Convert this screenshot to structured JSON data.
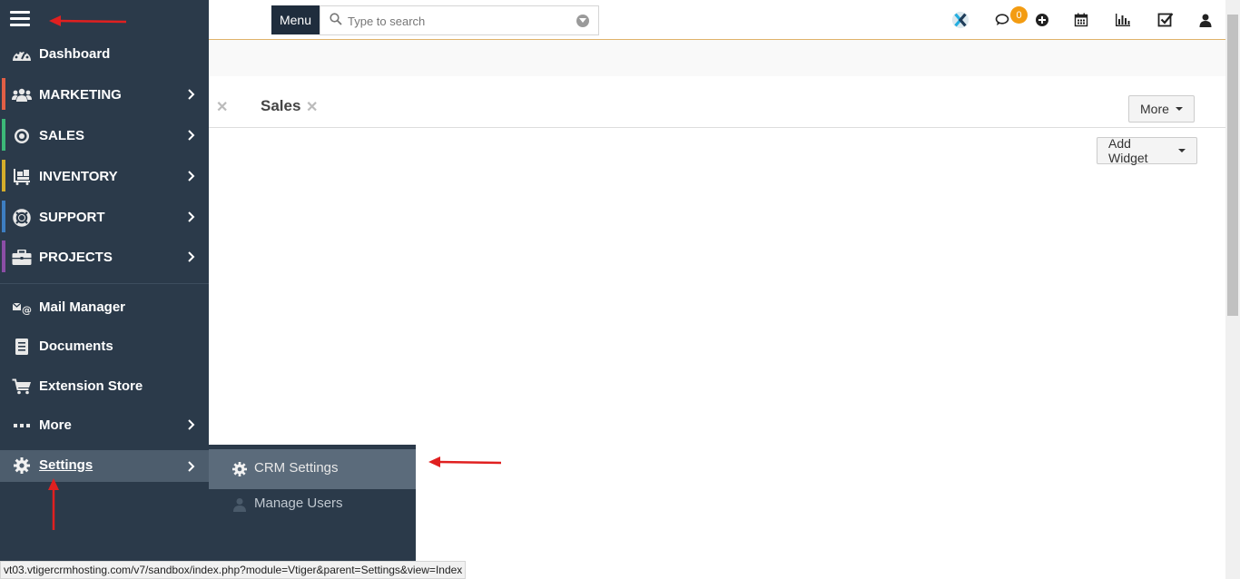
{
  "topbar": {
    "menu_label": "Menu",
    "search": {
      "placeholder": "Type to search"
    },
    "notification_count": "0"
  },
  "tabs": [
    {
      "label": "Sales"
    }
  ],
  "buttons": {
    "more_label": "More",
    "add_widget_label": "Add Widget"
  },
  "sidebar": {
    "items": [
      {
        "label": "Dashboard",
        "icon": "dashboard-icon"
      },
      {
        "label": "MARKETING",
        "icon": "users-icon",
        "color": "#e15f45"
      },
      {
        "label": "SALES",
        "icon": "target-icon",
        "color": "#3cb878"
      },
      {
        "label": "INVENTORY",
        "icon": "inventory-icon",
        "color": "#d4ad2b"
      },
      {
        "label": "SUPPORT",
        "icon": "lifebuoy-icon",
        "color": "#3d7ec1"
      },
      {
        "label": "PROJECTS",
        "icon": "briefcase-icon",
        "color": "#8b4ea6"
      },
      {
        "label": "Mail Manager",
        "icon": "mail-icon"
      },
      {
        "label": "Documents",
        "icon": "document-icon"
      },
      {
        "label": "Extension Store",
        "icon": "cart-icon"
      },
      {
        "label": "More",
        "icon": "ellipsis-icon"
      },
      {
        "label": "Settings",
        "icon": "gear-icon"
      }
    ]
  },
  "submenu": {
    "items": [
      {
        "label": "CRM Settings",
        "icon": "gear-icon"
      },
      {
        "label": "Manage Users",
        "icon": "user-icon"
      }
    ]
  },
  "status_url": "vt03.vtigercrmhosting.com/v7/sandbox/index.php?module=Vtiger&parent=Settings&view=Index",
  "colors": {
    "sidebar_bg": "#2b3a4a",
    "accent_red": "#e02020",
    "badge": "#f39c12"
  }
}
